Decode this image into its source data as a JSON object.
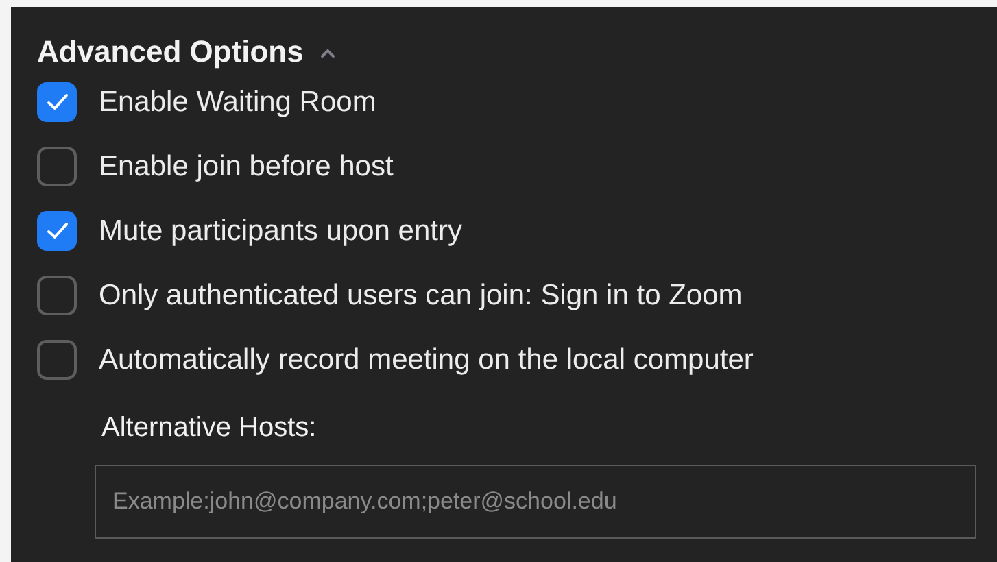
{
  "section": {
    "title": "Advanced Options",
    "expanded": true
  },
  "options": [
    {
      "label": "Enable Waiting Room",
      "checked": true
    },
    {
      "label": "Enable join before host",
      "checked": false
    },
    {
      "label": "Mute participants upon entry",
      "checked": true
    },
    {
      "label": "Only authenticated users can join: Sign in to Zoom",
      "checked": false
    },
    {
      "label": "Automatically record meeting on the local computer",
      "checked": false
    }
  ],
  "alternative_hosts": {
    "label": "Alternative Hosts:",
    "placeholder": "Example:john@company.com;peter@school.edu"
  }
}
